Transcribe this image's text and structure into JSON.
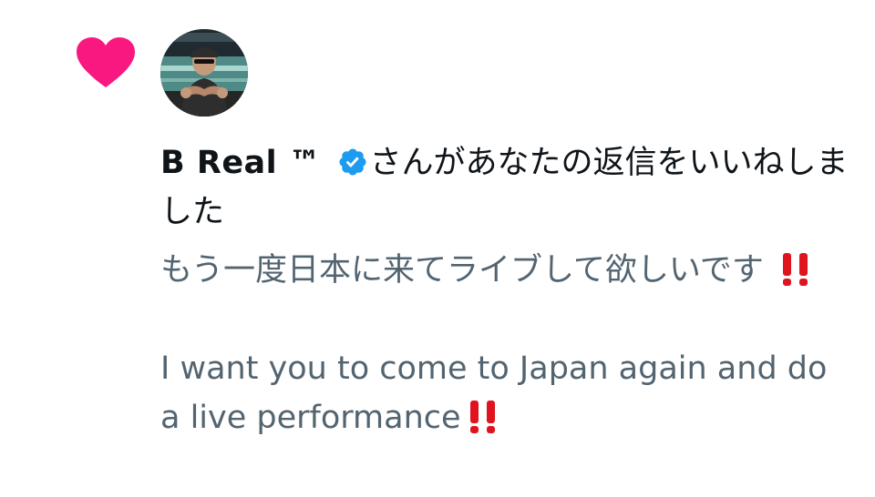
{
  "notification": {
    "type_icon": "heart-icon",
    "accent_color": "#f91880",
    "avatar_icon": "user-avatar",
    "user_name": "B Real ™",
    "verified_icon": "verified-badge-icon",
    "verified_color": "#1d9bf0",
    "action_text": "さんがあなたの返信をいいねしました",
    "reply": {
      "line_jp": "もう一度日本に来てライブして欲しいです",
      "line_en": "I want you to come to Japan again and do a live performance",
      "emphasis_icon": "double-exclamation-icon",
      "emphasis_color": "#e0141e"
    }
  }
}
